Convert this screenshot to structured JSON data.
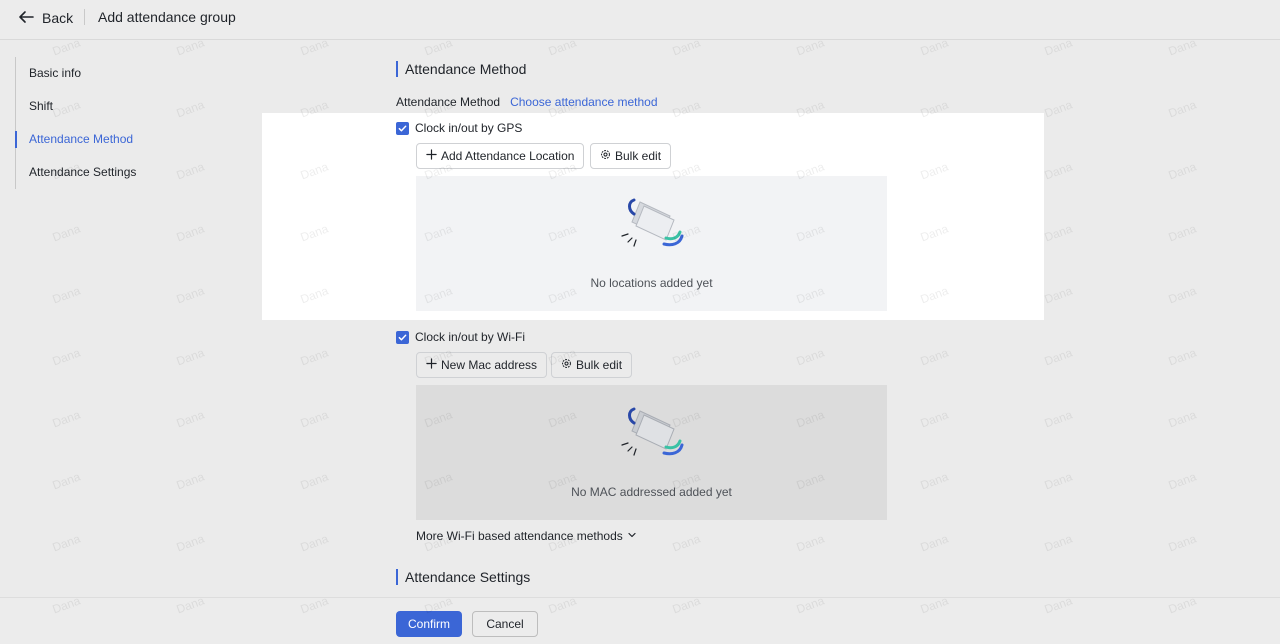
{
  "header": {
    "back_label": "Back",
    "title": "Add attendance group"
  },
  "sidebar": {
    "items": [
      {
        "label": "Basic info"
      },
      {
        "label": "Shift"
      },
      {
        "label": "Attendance Method",
        "active": true
      },
      {
        "label": "Attendance Settings"
      }
    ]
  },
  "main": {
    "section_method_title": "Attendance Method",
    "method_label": "Attendance Method",
    "method_link": "Choose attendance method",
    "gps": {
      "checkbox_label": "Clock in/out by GPS",
      "checked": true,
      "add_button": "Add Attendance Location",
      "bulk_button": "Bulk edit",
      "empty_text": "No locations added yet"
    },
    "wifi": {
      "checkbox_label": "Clock in/out by Wi-Fi",
      "checked": true,
      "add_button": "New Mac address",
      "bulk_button": "Bulk edit",
      "empty_text": "No MAC addressed added yet"
    },
    "more_link": "More Wi-Fi based attendance methods",
    "section_settings_title": "Attendance Settings"
  },
  "footer": {
    "confirm": "Confirm",
    "cancel": "Cancel"
  },
  "watermark": "Dana",
  "colors": {
    "accent": "#3b66d6",
    "background": "#ebebeb",
    "panel": "#ffffff"
  },
  "icons": [
    "back-arrow-icon",
    "check-icon",
    "plus-icon",
    "gear-icon",
    "empty-folder-icon",
    "chevron-down-icon"
  ]
}
